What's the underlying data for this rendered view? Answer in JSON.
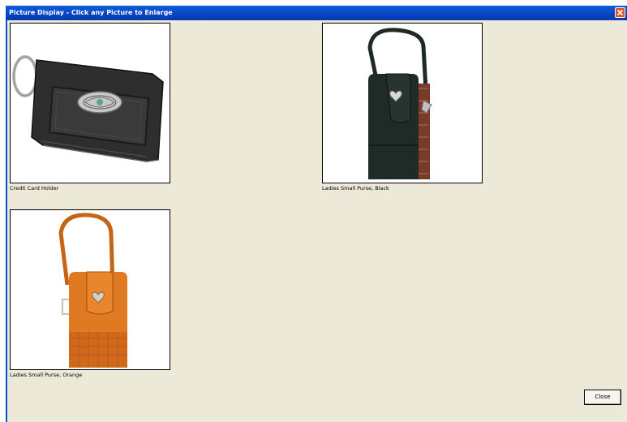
{
  "window": {
    "title": "Picture Display - Click any Picture to Enlarge"
  },
  "pictures": [
    {
      "caption": "Credit Card Holder",
      "image": "credit-card-holder"
    },
    {
      "caption": "Ladies Small Purse, Black",
      "image": "black-purse"
    },
    {
      "caption": "Ladies Small Purse, Orange",
      "image": "orange-purse"
    }
  ],
  "buttons": {
    "close_label": "Close"
  },
  "colors": {
    "titlebar": "#0a48c8",
    "window_bg": "#ece9d8",
    "close_icon": "#e0512f"
  }
}
